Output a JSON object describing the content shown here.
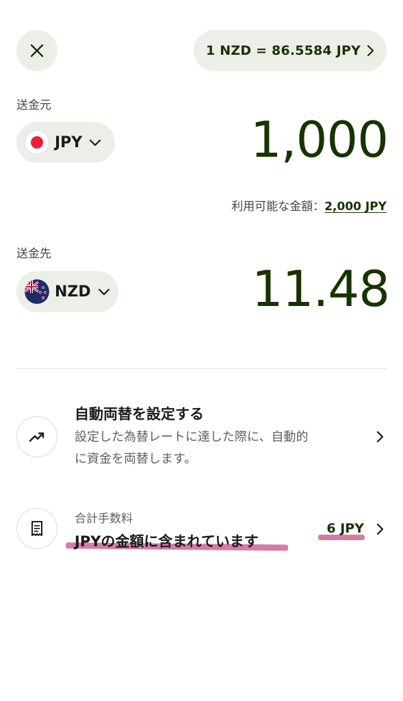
{
  "header": {
    "close_icon": "close-icon",
    "rate_label": "1 NZD = 86.5584 JPY"
  },
  "from": {
    "label": "送金元",
    "currency": "JPY",
    "flag": "japan-flag",
    "amount": "1,000",
    "available_prefix": "利用可能な金額：",
    "available_value": "2,000 JPY"
  },
  "to": {
    "label": "送金先",
    "currency": "NZD",
    "flag": "new-zealand-flag",
    "amount": "11.48"
  },
  "auto_exchange": {
    "icon": "trending-up-icon",
    "title": "自動両替を設定する",
    "desc_line1": "設定した為替レートに達した際に、自動的",
    "desc_line2": "に資金を両替します。"
  },
  "fee": {
    "icon": "receipt-icon",
    "label": "合計手数料",
    "description": "JPYの金額に含まれています",
    "value": "6 JPY"
  },
  "colors": {
    "accent_dark_green": "#163300",
    "pill_bg": "#eceee8",
    "highlight_pink": "#d57ca6"
  }
}
